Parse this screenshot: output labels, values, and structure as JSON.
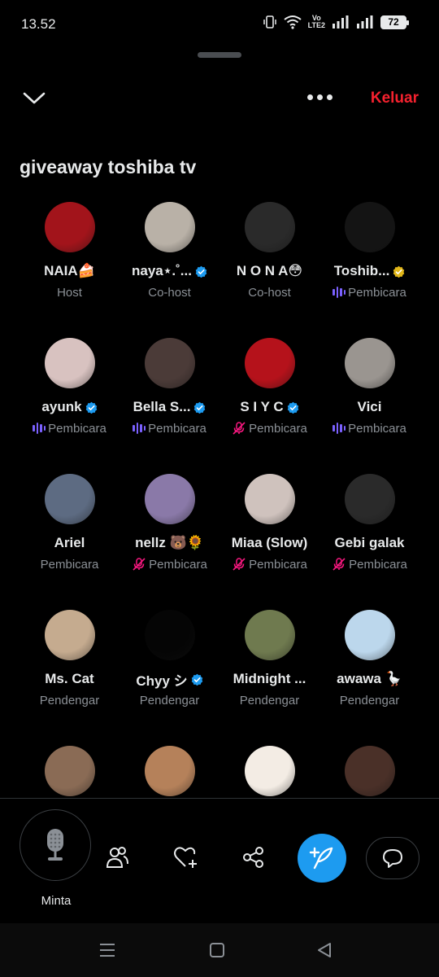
{
  "status_bar": {
    "time": "13.52",
    "network_label_top": "Vo",
    "network_label_bottom": "LTE2",
    "battery": "72"
  },
  "header": {
    "leave_label": "Keluar"
  },
  "space": {
    "title": "giveaway toshiba tv"
  },
  "colors": {
    "accent": "#1d9bf0",
    "leave": "#f4212e",
    "speaking": "#7b61ff",
    "muted": "#f91880",
    "secondary_text": "#8b9096"
  },
  "participants": [
    {
      "name": "NAIA🍰",
      "role": "Host",
      "verified": false,
      "indicator": "none",
      "avatar_color": "#a2141b"
    },
    {
      "name": "naya⋆.˚...",
      "role": "Co-host",
      "verified": true,
      "indicator": "none",
      "avatar_color": "#b9b1a7"
    },
    {
      "name": "N O N A😳",
      "role": "Co-host",
      "verified": false,
      "indicator": "none",
      "avatar_color": "#2a2a2a"
    },
    {
      "name": "Toshib...",
      "role": "Pembicara",
      "verified": true,
      "verified_gold": true,
      "indicator": "speaking",
      "avatar_color": "#141414"
    },
    {
      "name": "ayunk",
      "role": "Pembicara",
      "verified": true,
      "indicator": "speaking",
      "avatar_color": "#d8c2c0"
    },
    {
      "name": "Bella S...",
      "role": "Pembicara",
      "verified": true,
      "indicator": "speaking",
      "avatar_color": "#4b3b38"
    },
    {
      "name": "S I Y C",
      "role": "Pembicara",
      "verified": true,
      "indicator": "muted",
      "avatar_color": "#b5121b"
    },
    {
      "name": "Vici",
      "role": "Pembicara",
      "verified": false,
      "indicator": "speaking",
      "avatar_color": "#9a9590"
    },
    {
      "name": "Ariel",
      "role": "Pembicara",
      "verified": false,
      "indicator": "none",
      "avatar_color": "#5d6b82"
    },
    {
      "name": "nellz 🐻🌻",
      "role": "Pembicara",
      "verified": false,
      "indicator": "muted",
      "avatar_color": "#8a79a8"
    },
    {
      "name": "Miaa (Slow)",
      "role": "Pembicara",
      "verified": false,
      "indicator": "muted",
      "avatar_color": "#cfc2bd"
    },
    {
      "name": "Gebi galak",
      "role": "Pembicara",
      "verified": false,
      "indicator": "muted",
      "avatar_color": "#2a2a2a"
    },
    {
      "name": "Ms. Cat",
      "role": "Pendengar",
      "verified": false,
      "indicator": "none",
      "avatar_color": "#c5ab8f"
    },
    {
      "name": "Chyy シ",
      "role": "Pendengar",
      "verified": true,
      "indicator": "none",
      "avatar_color": "#050505"
    },
    {
      "name": "Midnight ...",
      "role": "Pendengar",
      "verified": false,
      "indicator": "none",
      "avatar_color": "#6f7a4f"
    },
    {
      "name": "awawa 🪿",
      "role": "Pendengar",
      "verified": false,
      "indicator": "none",
      "avatar_color": "#bcd7ec"
    },
    {
      "name": "",
      "role": "",
      "verified": false,
      "indicator": "none",
      "avatar_color": "#8a6b55"
    },
    {
      "name": "",
      "role": "",
      "verified": false,
      "indicator": "none",
      "avatar_color": "#b5815a"
    },
    {
      "name": "",
      "role": "",
      "verified": false,
      "indicator": "none",
      "avatar_color": "#f3ece4"
    },
    {
      "name": "",
      "role": "",
      "verified": false,
      "indicator": "none",
      "avatar_color": "#4a3028"
    }
  ],
  "bottom_bar": {
    "request_label": "Minta"
  }
}
